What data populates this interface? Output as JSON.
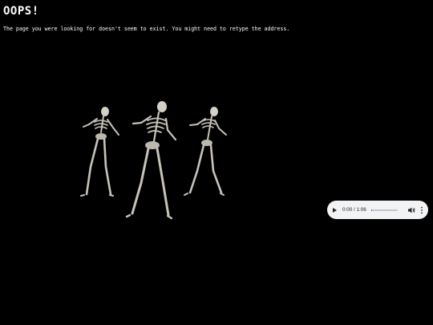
{
  "heading": "OOPS!",
  "message": "The page you were looking for doesn't seem to exist. You might need to retype the address.",
  "audio_player": {
    "time_display": "0:00 / 1:06",
    "progress": 0.03,
    "play_icon": "play-icon",
    "volume_icon": "volume-icon",
    "menu_icon": "more-vertical-icon"
  },
  "colors": {
    "background": "#000000",
    "text": "#ffffff",
    "player_background": "#f1f3f4",
    "skeleton": "#c8c3b9"
  }
}
